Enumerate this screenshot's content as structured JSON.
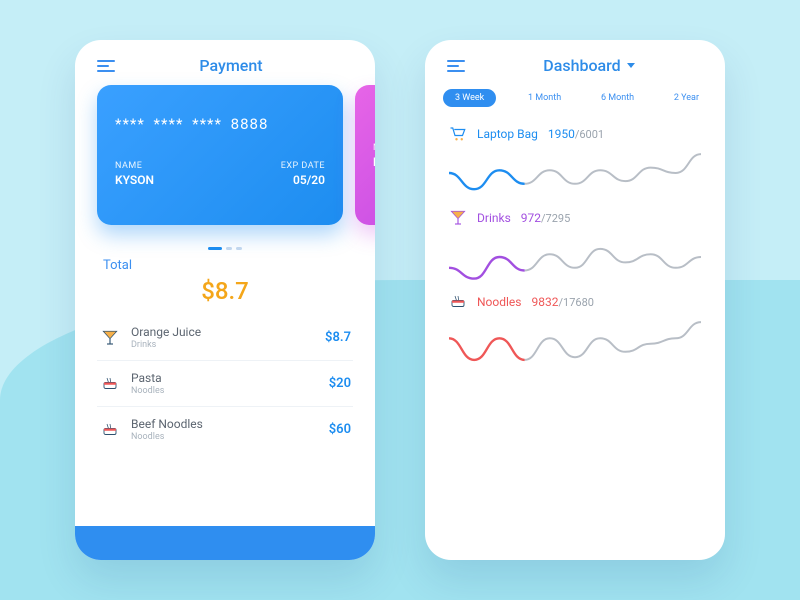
{
  "payment": {
    "title": "Payment",
    "card": {
      "number": "****  ****  ****  8888",
      "name_label": "NAME",
      "name": "KYSON",
      "exp_label": "EXP DATE",
      "exp": "05/20"
    },
    "alt_card": {
      "name_label": "NA",
      "name": "KY"
    },
    "total_label": "Total",
    "total_amount": "$8.7",
    "items": [
      {
        "icon": "cocktail",
        "name": "Orange Juice",
        "category": "Drinks",
        "price": "$8.7"
      },
      {
        "icon": "noodles",
        "name": "Pasta",
        "category": "Noodles",
        "price": "$20"
      },
      {
        "icon": "noodles",
        "name": "Beef Noodles",
        "category": "Noodles",
        "price": "$60"
      }
    ]
  },
  "dashboard": {
    "title": "Dashboard",
    "tabs": [
      "3 Week",
      "1 Month",
      "6 Month",
      "2 Year"
    ],
    "active_tab": 0,
    "metrics": [
      {
        "icon": "cart",
        "name": "Laptop Bag",
        "current": "1950",
        "total": "6001",
        "color": "#1d8df0"
      },
      {
        "icon": "cocktail",
        "name": "Drinks",
        "current": "972",
        "total": "7295",
        "color": "#a24fe0"
      },
      {
        "icon": "noodles",
        "name": "Noodles",
        "current": "9832",
        "total": "17680",
        "color": "#ef5757"
      }
    ]
  },
  "chart_data": [
    {
      "type": "line",
      "title": "Laptop Bag — 3 Week",
      "series": [
        {
          "name": "Laptop Bag",
          "values": [
            50,
            20,
            55,
            30,
            55,
            30,
            55,
            35,
            60,
            50,
            85
          ]
        }
      ],
      "ylim": [
        0,
        100
      ],
      "legend": false
    },
    {
      "type": "line",
      "title": "Drinks — 3 Week",
      "series": [
        {
          "name": "Drinks",
          "values": [
            30,
            10,
            50,
            25,
            55,
            30,
            65,
            40,
            55,
            30,
            50
          ]
        }
      ],
      "ylim": [
        0,
        100
      ],
      "legend": false
    },
    {
      "type": "line",
      "title": "Noodles — 3 Week",
      "series": [
        {
          "name": "Noodles",
          "values": [
            55,
            15,
            55,
            15,
            55,
            20,
            55,
            30,
            45,
            55,
            85
          ]
        }
      ],
      "ylim": [
        0,
        100
      ],
      "legend": false
    }
  ]
}
